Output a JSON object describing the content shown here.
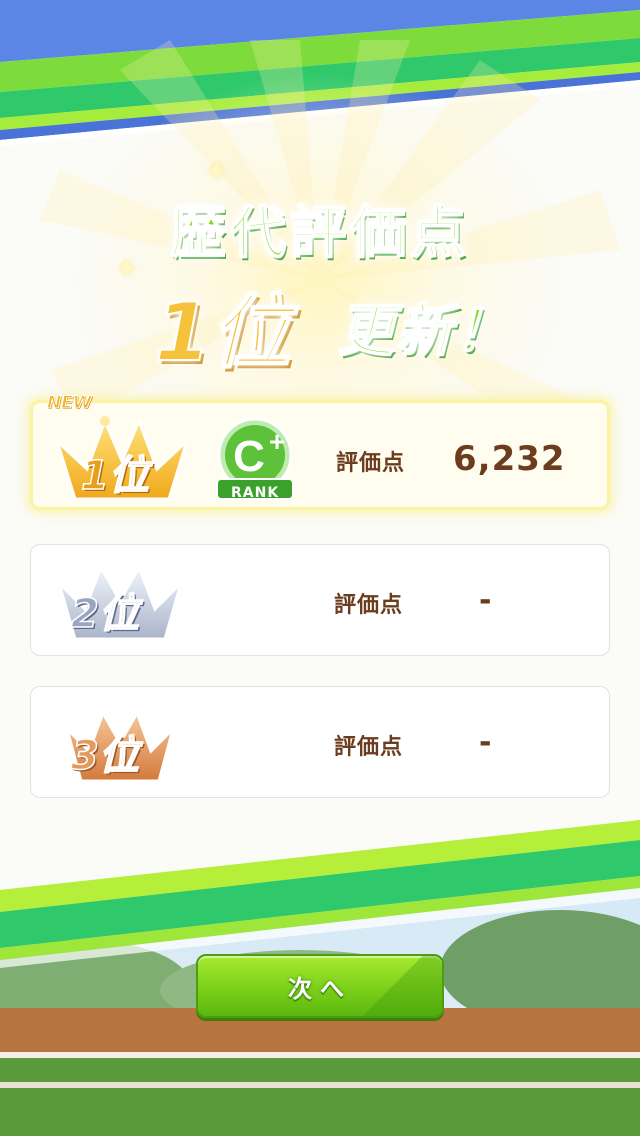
{
  "headline": {
    "title": "歴代評価点",
    "rank": "1位",
    "update": "更新！"
  },
  "records": [
    {
      "is_new": true,
      "new_label": "NEW",
      "rank_label": "1位",
      "grade": "C+",
      "grade_caption": "RANK",
      "score_label": "評価点",
      "score": "6,232"
    },
    {
      "is_new": false,
      "rank_label": "2位",
      "score_label": "評価点",
      "score": "-"
    },
    {
      "is_new": false,
      "rank_label": "3位",
      "score_label": "評価点",
      "score": "-"
    }
  ],
  "next_button": {
    "label": "次へ"
  },
  "colors": {
    "accent_green": "#7ddc1c",
    "gold": "#f6c23a",
    "score_brown": "#6b3d1e",
    "silver": "#8d9bb8",
    "bronze": "#d98a4e"
  },
  "icons": [
    "crown-gold-icon",
    "crown-silver-icon",
    "crown-bronze-icon",
    "rank-c-plus-icon",
    "sparkle-icon"
  ]
}
